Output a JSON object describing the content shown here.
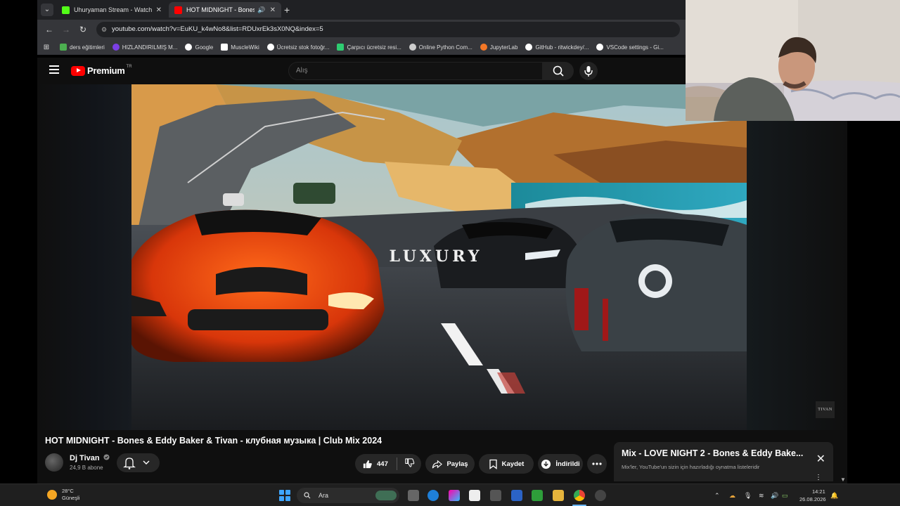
{
  "browser": {
    "tabs": [
      {
        "title": "Uhuryaman Stream - Watch Liv",
        "favicon_color": "#53fc18",
        "active": false
      },
      {
        "title": "HOT MIDNIGHT - Bones & E",
        "favicon_color": "#ff0000",
        "active": true
      }
    ],
    "url": "youtube.com/watch?v=EuKU_k4wNo8&list=RDUxrEk3sX0NQ&index=5",
    "bookmarks": [
      {
        "label": "ders eğitimleri",
        "icon_color": "#4caf50"
      },
      {
        "label": "HIZLANDIRILMIŞ M...",
        "icon_color": "#7b3fe4"
      },
      {
        "label": "Google",
        "icon_color": "#ffffff"
      },
      {
        "label": "MuscleWiki",
        "icon_color": "#ffffff"
      },
      {
        "label": "Ücretsiz stok fotoğr...",
        "icon_color": "#ffffff"
      },
      {
        "label": "Çarpıcı ücretsiz resi...",
        "icon_color": "#2ecc71"
      },
      {
        "label": "Online Python Com...",
        "icon_color": "#cccccc"
      },
      {
        "label": "JupyterLab",
        "icon_color": "#f37726"
      },
      {
        "label": "GitHub - ritwickdey/...",
        "icon_color": "#ffffff"
      },
      {
        "label": "VSCode settings - Gi...",
        "icon_color": "#ffffff"
      }
    ]
  },
  "youtube": {
    "logo_text": "Premium",
    "country_code": "TR",
    "search_placeholder": "Alış",
    "video": {
      "overlay_text": "LUXURY",
      "watermark": "TIVAN",
      "title": "HOT MIDNIGHT - Bones & Eddy Baker & Tivan - клубная музыка | Club Mix 2024"
    },
    "channel": {
      "name": "Dj Tivan",
      "verified_icon": "check-circle-icon",
      "subscribers": "24,9 B abone"
    },
    "actions": {
      "likes": "447",
      "share": "Paylaş",
      "save": "Kaydet",
      "download": "İndirildi"
    },
    "mix": {
      "title": "Mix - LOVE NIGHT 2 - Bones & Eddy Bake...",
      "subtitle": "Mix'ler, YouTube'un sizin için hazırladığı oynatma listeleridir"
    }
  },
  "taskbar": {
    "weather_temp": "28°C",
    "weather_desc": "Güneşli",
    "search_placeholder": "Ara",
    "time": "14:21",
    "date": "26.08.2026"
  }
}
